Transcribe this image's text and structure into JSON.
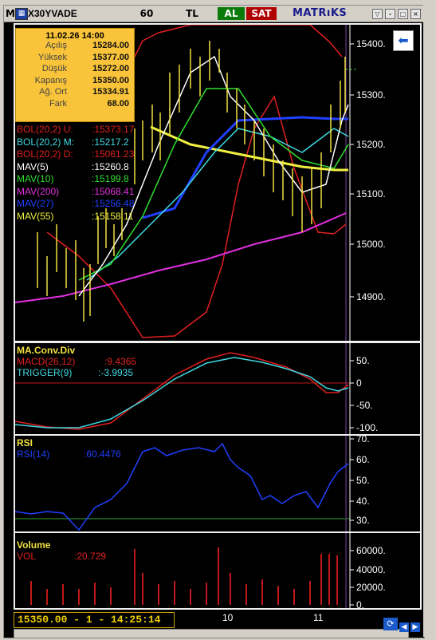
{
  "window": {
    "menu_letter": "M",
    "symbol": "X30YVADE",
    "period": "60",
    "currency": "TL",
    "buy_label": "AL",
    "sell_label": "SAT",
    "brand": "MATRıKS"
  },
  "info_box": {
    "datetime": "11.02.26 14:00",
    "rows": [
      {
        "key": "Açılış",
        "value": "15284.00"
      },
      {
        "key": "Yüksek",
        "value": "15377.00"
      },
      {
        "key": "Düşük",
        "value": "15272.00"
      },
      {
        "key": "Kapanış",
        "value": "15350.00"
      },
      {
        "key": "Ağ. Ort",
        "value": "15334.91"
      },
      {
        "key": "Fark",
        "value": "68.00"
      }
    ]
  },
  "indicators": [
    {
      "label": "BOL(20,2) U:",
      "value": ":15373.17",
      "color": "#e02020"
    },
    {
      "label": "BOL(20,2) M:",
      "value": ":15217.2",
      "color": "#40d8e0"
    },
    {
      "label": "BOL(20,2) D:",
      "value": ":15061.23",
      "color": "#e02020"
    },
    {
      "label": "MAV(5)",
      "value": ":15260.8",
      "color": "#ffffff"
    },
    {
      "label": "MAV(10)",
      "value": ":15199.8",
      "color": "#30e030"
    },
    {
      "label": "MAV(200)",
      "value": ":15068.41",
      "color": "#e030e0"
    },
    {
      "label": "MAV(27)",
      "value": ":15256.48",
      "color": "#2040ff"
    },
    {
      "label": "MAV(55)",
      "value": ":15158.11",
      "color": "#f0f040"
    }
  ],
  "price_axis": [
    "15400.",
    "15300.",
    "15200.",
    "15100.",
    "15000.",
    "14900."
  ],
  "macd": {
    "title": "MA.Conv.Div",
    "macd_label": "MACD(26,12)",
    "macd_value": ":9.4365",
    "trigger_label": "TRIGGER(9)",
    "trigger_value": ":-3.9935",
    "axis": [
      "50.",
      "0",
      "-50.",
      "-100."
    ]
  },
  "rsi": {
    "title": "RSI",
    "label": "RSI(14)",
    "value": ":60.4476",
    "axis": [
      "70.",
      "60.",
      "50.",
      "40.",
      "30."
    ]
  },
  "volume": {
    "title": "Volume",
    "label": "VOL",
    "value": ":20.729",
    "axis": [
      "60000.",
      "40000.",
      "20000.",
      "0."
    ]
  },
  "time_axis": [
    "10",
    "11"
  ],
  "status_text": "15350.00 - 1 - 14:25:14",
  "colors": {
    "bollinger": "#e02020",
    "bol_mid": "#40d8e0",
    "mav5": "#ffffff",
    "mav10": "#30e030",
    "mav200": "#e030e0",
    "mav27": "#2040ff",
    "mav55": "#f0f040",
    "candles": "#f0e040",
    "macd": "#e02020",
    "trigger": "#40d8e0",
    "rsi": "#2040ff",
    "volume": "#c01818"
  }
}
